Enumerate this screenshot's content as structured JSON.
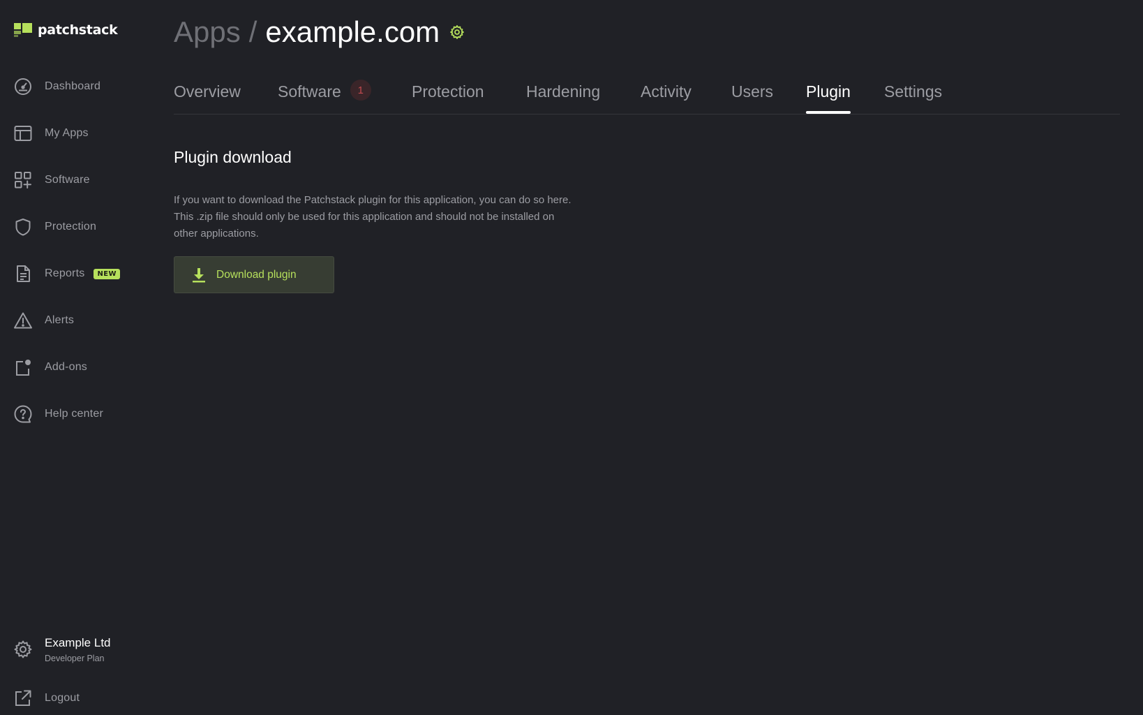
{
  "brand": {
    "name": "patchstack",
    "accent": "#b6e05c"
  },
  "sidebar": {
    "items": [
      {
        "label": "Dashboard",
        "icon": "dashboard-gauge-icon"
      },
      {
        "label": "My Apps",
        "icon": "layout-icon"
      },
      {
        "label": "Software",
        "icon": "apps-grid-plus-icon"
      },
      {
        "label": "Protection",
        "icon": "shield-icon"
      },
      {
        "label": "Reports",
        "icon": "document-icon",
        "badge": "NEW"
      },
      {
        "label": "Alerts",
        "icon": "warning-triangle-icon"
      },
      {
        "label": "Add-ons",
        "icon": "addon-icon"
      },
      {
        "label": "Help center",
        "icon": "help-circle-icon"
      }
    ],
    "account": {
      "name": "Example Ltd",
      "plan": "Developer Plan",
      "icon": "gear-icon"
    },
    "logout": {
      "label": "Logout",
      "icon": "external-link-icon"
    }
  },
  "header": {
    "breadcrumb_root": "Apps",
    "separator": "/",
    "current": "example.com",
    "settings_icon": "gear-icon"
  },
  "tabs": [
    {
      "label": "Overview"
    },
    {
      "label": "Software",
      "count": "1"
    },
    {
      "label": "Protection"
    },
    {
      "label": "Hardening"
    },
    {
      "label": "Activity"
    },
    {
      "label": "Users"
    },
    {
      "label": "Plugin",
      "active": true
    },
    {
      "label": "Settings"
    }
  ],
  "plugin": {
    "title": "Plugin download",
    "description_lines": [
      "If you want to download the Patchstack plugin for this application, you can do so here.",
      "This .zip file should only be used for this application and should not be installed on",
      "other applications."
    ],
    "download_label": "Download plugin",
    "download_icon": "download-icon"
  }
}
